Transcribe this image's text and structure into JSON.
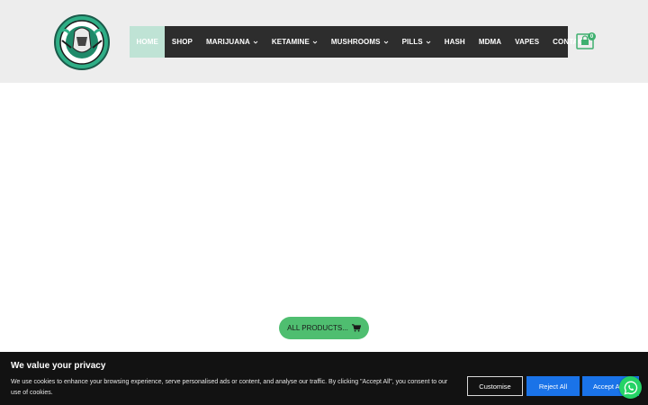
{
  "header": {
    "nav": [
      {
        "label": "HOME",
        "dropdown": false,
        "active": true
      },
      {
        "label": "SHOP",
        "dropdown": false
      },
      {
        "label": "MARIJUANA",
        "dropdown": true
      },
      {
        "label": "KETAMINE",
        "dropdown": true
      },
      {
        "label": "MUSHROOMS",
        "dropdown": true
      },
      {
        "label": "PILLS",
        "dropdown": true
      },
      {
        "label": "HASH",
        "dropdown": false
      },
      {
        "label": "MDMA",
        "dropdown": false
      },
      {
        "label": "VAPES",
        "dropdown": false
      },
      {
        "label": "CONTACT",
        "dropdown": false
      }
    ],
    "cart_count": "0",
    "icons": {
      "logo": "store-logo-icon",
      "cart": "shopping-bag-icon"
    }
  },
  "main": {
    "all_products_label": "ALL PRODUCTS...",
    "all_products_icon": "shopping-cart-icon"
  },
  "cookie": {
    "title": "We value your privacy",
    "text": "We use cookies to enhance your browsing experience, serve personalised ads or content, and analyse our traffic. By clicking \"Accept All\", you consent to our use of cookies.",
    "customise_label": "Customise",
    "reject_label": "Reject All",
    "accept_label": "Accept All"
  },
  "colors": {
    "header_bg": "#ededed",
    "nav_bg": "#2d2d2d",
    "nav_active": "#bfe3d5",
    "accent_green": "#4fbe70",
    "cookie_bg": "#121212",
    "button_blue": "#1a73e8",
    "whatsapp_green": "#25d366"
  },
  "whatsapp_icon": "whatsapp-icon"
}
